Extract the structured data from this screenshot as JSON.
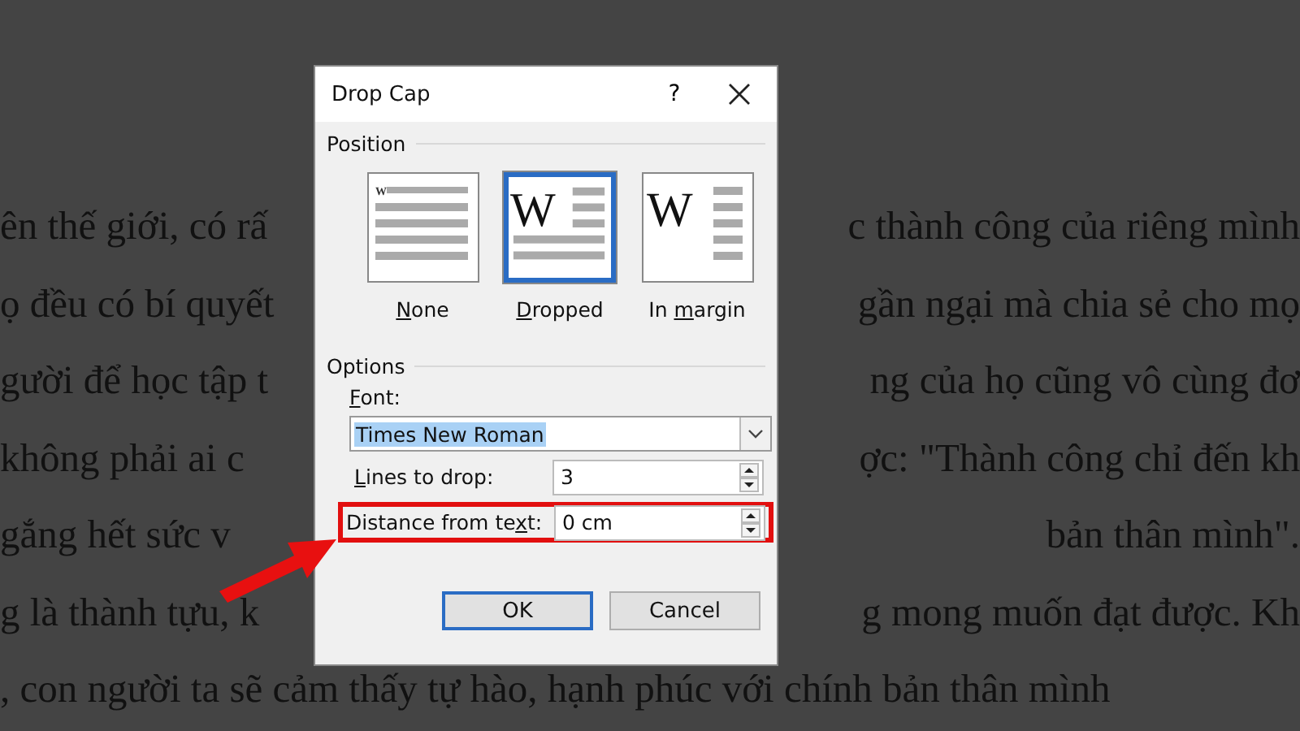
{
  "document": {
    "lines": [
      {
        "left": "ên thế giới, có rấ",
        "right": "c thành công của riêng mình"
      },
      {
        "left": "ọ đều có bí quyết",
        "right": "gần ngại mà chia sẻ cho mọ"
      },
      {
        "left": "gười để học tập t",
        "right": "ng của họ cũng vô cùng đơ"
      },
      {
        "left": "không phải ai c",
        "right": "ợc: \"Thành công chỉ đến kh"
      },
      {
        "left": "gắng hết sức v",
        "right": "bản thân mình\"."
      },
      {
        "left": "g là thành tựu, k",
        "right": "g mong muốn đạt được. Kh"
      },
      {
        "left": ", con người ta sẽ cảm thấy tự hào, hạnh phúc với chính bản thân mình"
      }
    ]
  },
  "dialog": {
    "title": "Drop Cap",
    "help": "?",
    "position": {
      "label": "Position",
      "options": [
        {
          "kind": "none",
          "letter": "W",
          "key": "N",
          "post": "one",
          "selected": false
        },
        {
          "kind": "dropped",
          "letter": "W",
          "key": "D",
          "post": "ropped",
          "selected": true
        },
        {
          "kind": "margin",
          "letter": "W",
          "pre": "In ",
          "key": "m",
          "post": "argin",
          "selected": false
        }
      ]
    },
    "options": {
      "label": "Options",
      "font": {
        "key": "F",
        "post": "ont:",
        "value": "Times New Roman",
        "text_selected": true
      },
      "fields": [
        {
          "key": "L",
          "post": "ines to drop:",
          "value": "3",
          "highlighted": false
        },
        {
          "pre": "Distance from te",
          "key": "x",
          "post": "t:",
          "value": "0 cm",
          "highlighted": true
        }
      ]
    },
    "buttons": [
      {
        "label": "OK",
        "default": true
      },
      {
        "label": "Cancel",
        "default": false
      }
    ]
  },
  "annotation": {
    "arrow": true
  }
}
